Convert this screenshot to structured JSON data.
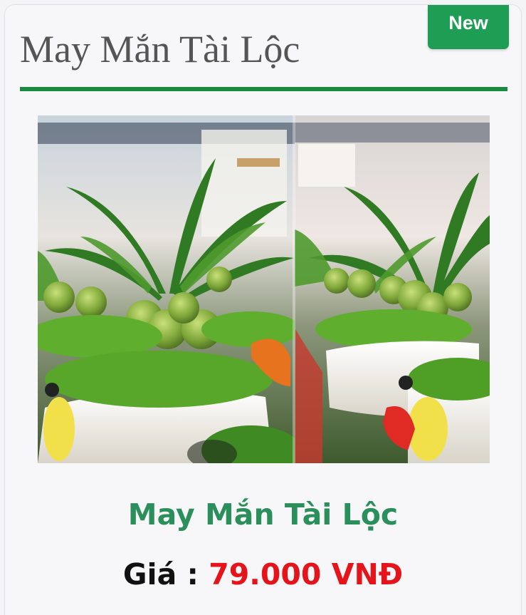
{
  "card": {
    "badge": "New",
    "header_title": "May Mắn Tài Lộc",
    "image": {
      "subject": "bonsai-coconut-plants-in-pots",
      "layout": "two-photos-side-by-side"
    },
    "product_name": "May Mắn Tài Lộc",
    "price_label": "Giá : ",
    "price_value": "79.000 VNĐ"
  },
  "colors": {
    "badge_bg": "#1e9e55",
    "divider": "#1a8a40",
    "product_name": "#2a8f5a",
    "price_value": "#e5141b"
  }
}
